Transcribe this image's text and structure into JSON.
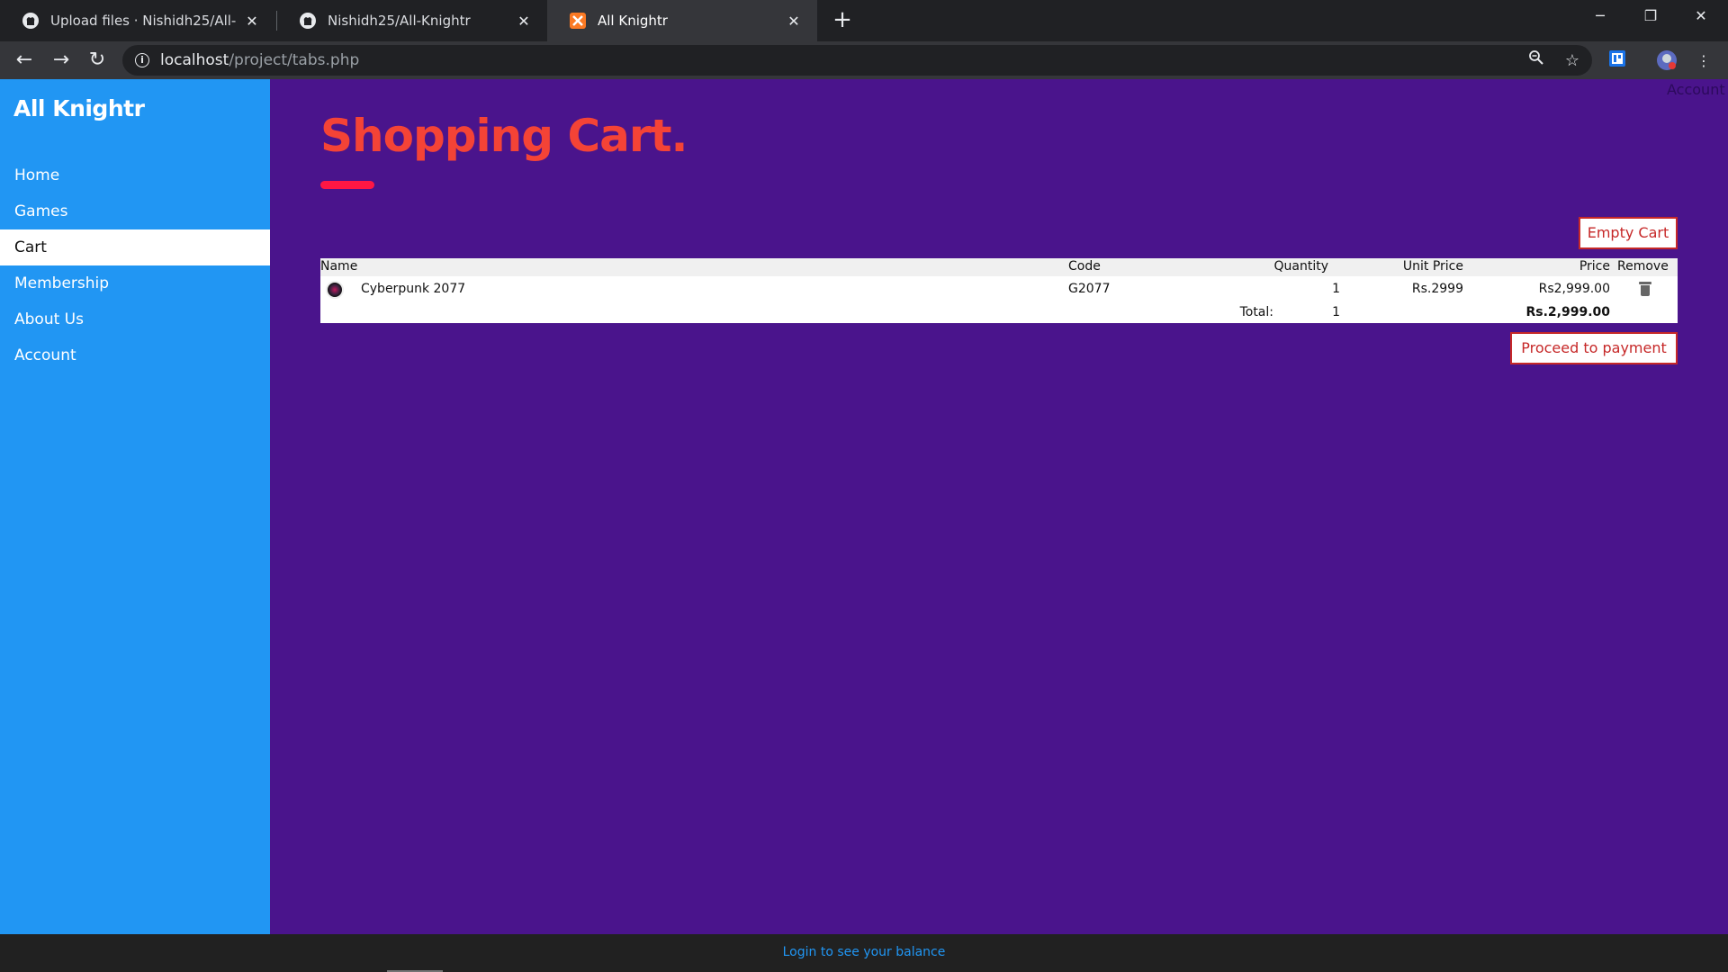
{
  "browser": {
    "tabs": [
      {
        "title": "Upload files · Nishidh25/All-Knightr",
        "icon": "github-icon"
      },
      {
        "title": "Nishidh25/All-Knightr",
        "icon": "github-icon"
      },
      {
        "title": "All Knightr",
        "icon": "xampp-icon"
      }
    ],
    "url_host": "localhost",
    "url_path": "/project/tabs.php"
  },
  "sidebar": {
    "brand": "All Knightr",
    "items": [
      {
        "label": "Home"
      },
      {
        "label": "Games"
      },
      {
        "label": "Cart"
      },
      {
        "label": "Membership"
      },
      {
        "label": "About Us"
      },
      {
        "label": "Account"
      }
    ],
    "active_item": "Cart"
  },
  "top_right_link": "Account",
  "page": {
    "title": "Shopping Cart.",
    "empty_cart_label": "Empty Cart",
    "proceed_label": "Proceed to payment"
  },
  "cart": {
    "headers": {
      "name": "Name",
      "code": "Code",
      "quantity": "Quantity",
      "unit_price": "Unit Price",
      "price": "Price",
      "remove": "Remove"
    },
    "items": [
      {
        "name": "Cyberpunk 2077",
        "code": "G2077",
        "quantity": "1",
        "unit_price": "Rs.2999",
        "price": "Rs2,999.00"
      }
    ],
    "total_label": "Total:",
    "total_quantity": "1",
    "total_price": "Rs.2,999.00"
  },
  "footer": {
    "link": "Login to see your balance"
  },
  "colors": {
    "page_bg": "#4a148c",
    "sidebar_bg": "#2196f3",
    "title": "#f44336",
    "title_bar": "#ff1744",
    "button_text": "#c62828",
    "footer_bg": "#212121",
    "footer_link": "#2196f3"
  }
}
